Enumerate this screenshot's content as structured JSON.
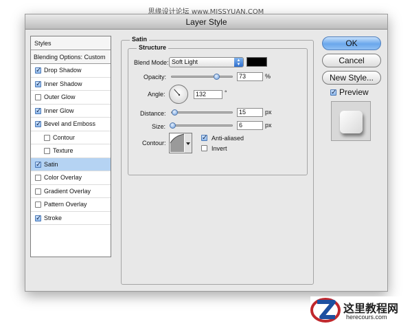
{
  "watermark": "思缘设计论坛 www.MISSYUAN.COM",
  "window": {
    "title": "Layer Style"
  },
  "sidebar": {
    "header": "Styles",
    "blending_options": "Blending Options: Custom",
    "items": [
      {
        "label": "Drop Shadow",
        "checked": true,
        "indent": false,
        "selected": false
      },
      {
        "label": "Inner Shadow",
        "checked": true,
        "indent": false,
        "selected": false
      },
      {
        "label": "Outer Glow",
        "checked": false,
        "indent": false,
        "selected": false
      },
      {
        "label": "Inner Glow",
        "checked": true,
        "indent": false,
        "selected": false
      },
      {
        "label": "Bevel and Emboss",
        "checked": true,
        "indent": false,
        "selected": false
      },
      {
        "label": "Contour",
        "checked": false,
        "indent": true,
        "selected": false
      },
      {
        "label": "Texture",
        "checked": false,
        "indent": true,
        "selected": false
      },
      {
        "label": "Satin",
        "checked": true,
        "indent": false,
        "selected": true
      },
      {
        "label": "Color Overlay",
        "checked": false,
        "indent": false,
        "selected": false
      },
      {
        "label": "Gradient Overlay",
        "checked": false,
        "indent": false,
        "selected": false
      },
      {
        "label": "Pattern Overlay",
        "checked": false,
        "indent": false,
        "selected": false
      },
      {
        "label": "Stroke",
        "checked": true,
        "indent": false,
        "selected": false
      }
    ]
  },
  "satin": {
    "group_title": "Satin",
    "structure_title": "Structure",
    "blend_mode_label": "Blend Mode:",
    "blend_mode_value": "Soft Light",
    "color_swatch": "#000000",
    "opacity_label": "Opacity:",
    "opacity_value": "73",
    "opacity_unit": "%",
    "opacity_fraction": 0.73,
    "angle_label": "Angle:",
    "angle_value": "132",
    "angle_unit": "°",
    "distance_label": "Distance:",
    "distance_value": "15",
    "distance_unit": "px",
    "distance_fraction": 0.06,
    "size_label": "Size:",
    "size_value": "6",
    "size_unit": "px",
    "size_fraction": 0.02,
    "contour_label": "Contour:",
    "anti_aliased_label": "Anti-aliased",
    "anti_aliased_checked": true,
    "invert_label": "Invert",
    "invert_checked": false
  },
  "buttons": {
    "ok": "OK",
    "cancel": "Cancel",
    "new_style": "New Style..."
  },
  "preview": {
    "label": "Preview",
    "checked": true
  },
  "logo": {
    "cn": "这里教程网",
    "en": "herecours.com"
  },
  "colors": {
    "accent": "#6aa7ec",
    "selection": "#b5d3f3"
  }
}
